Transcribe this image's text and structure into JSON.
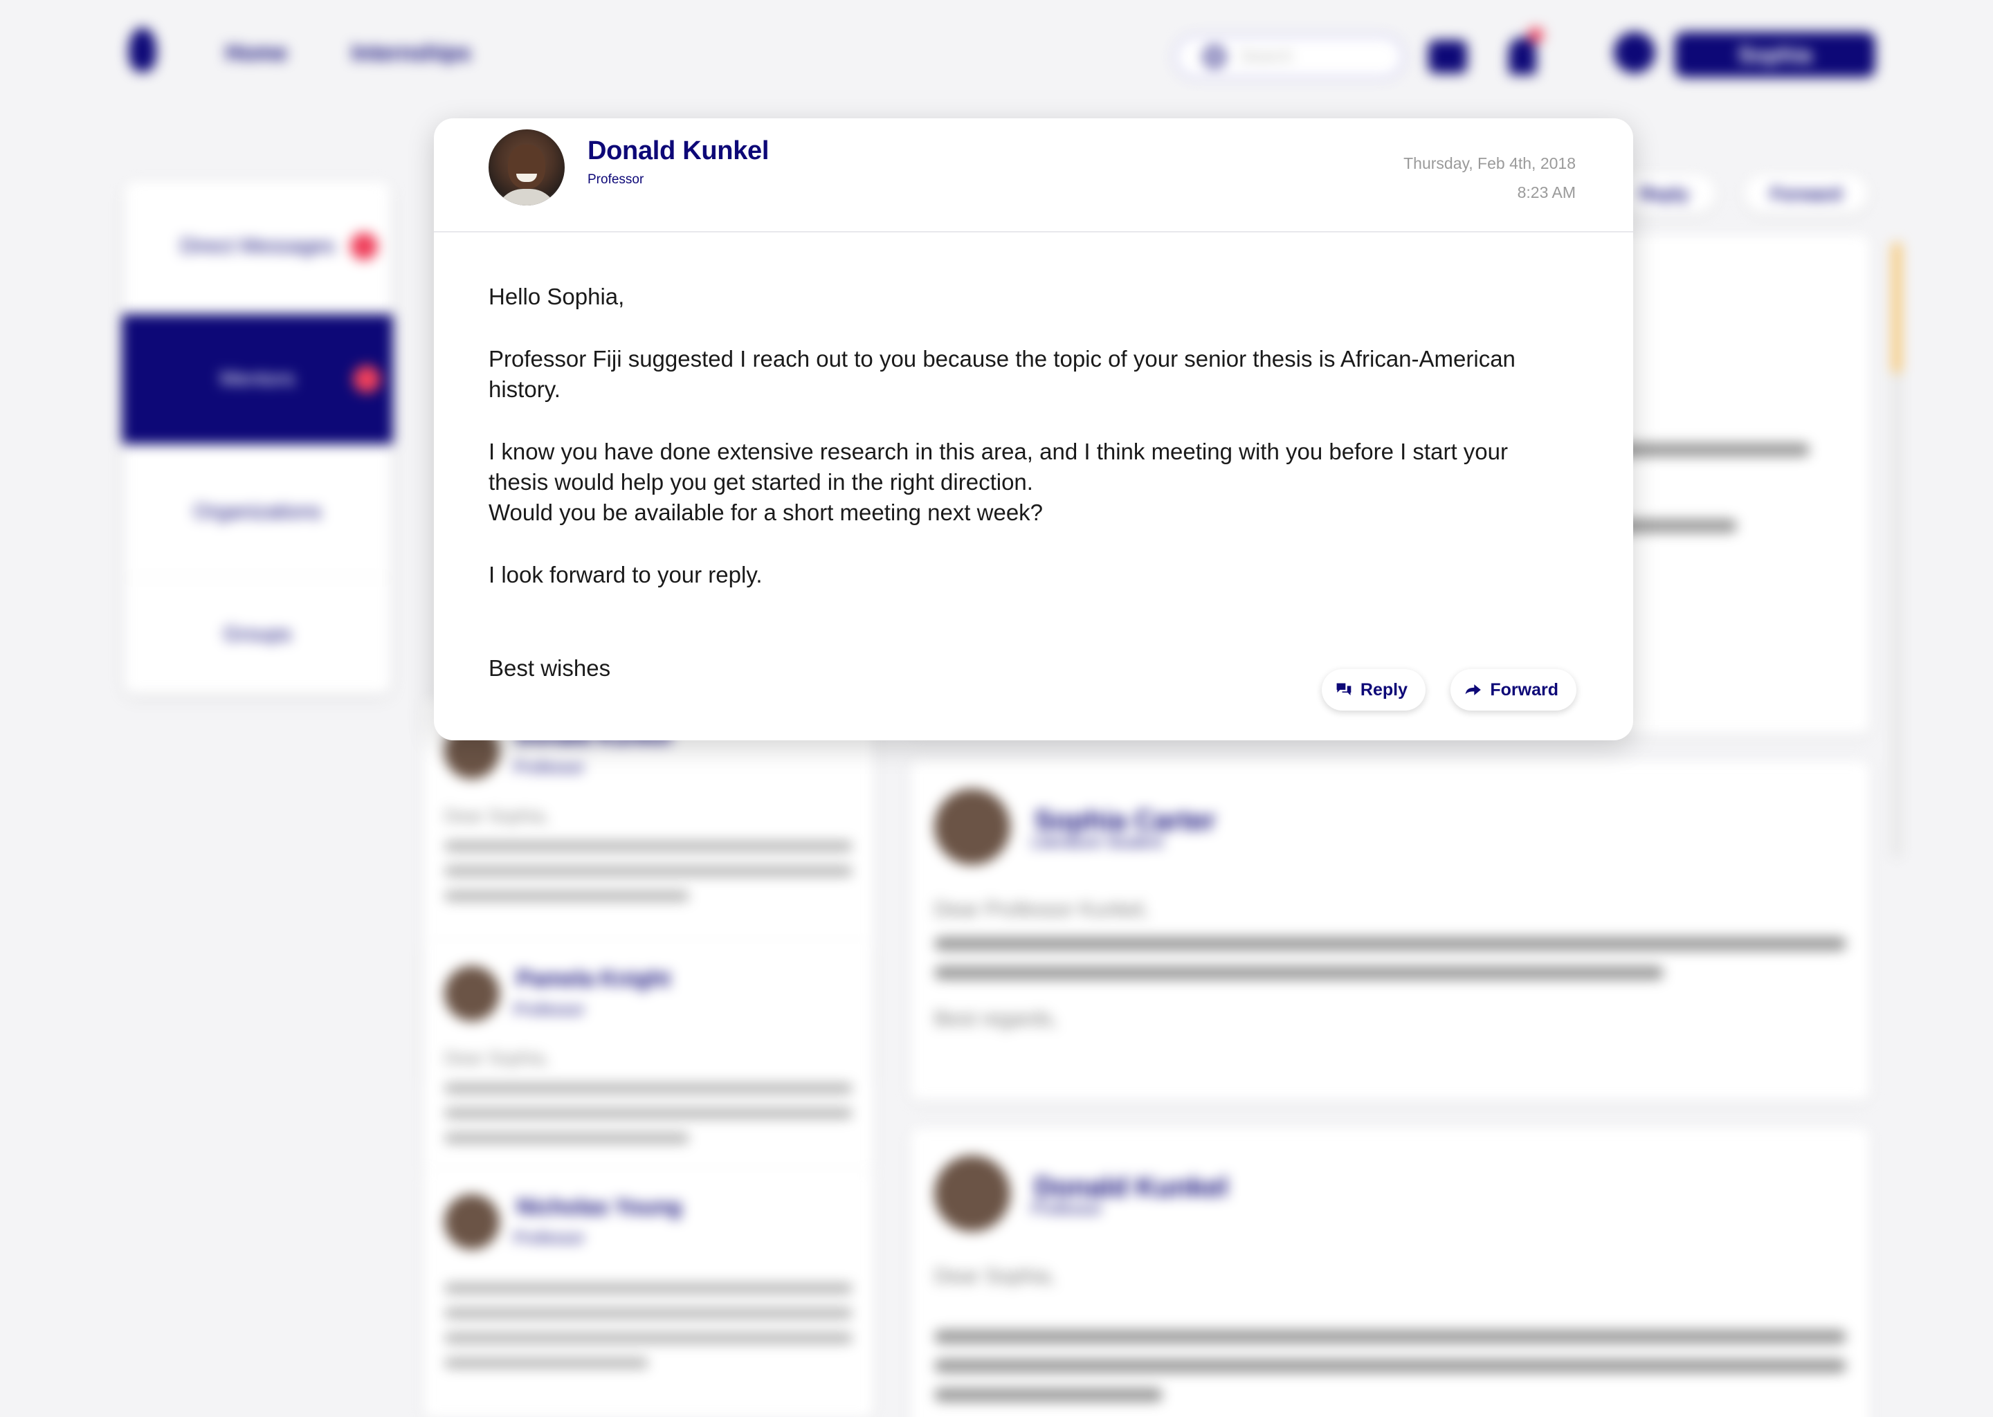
{
  "nav": {
    "links": [
      "Home",
      "Internships"
    ],
    "search_placeholder": "Search",
    "user_button": "Sophia"
  },
  "sidebar": {
    "items": [
      {
        "label": "Direct Messages",
        "badge": true
      },
      {
        "label": "Mentors",
        "badge": true,
        "active": true
      },
      {
        "label": "Organizations",
        "badge": false
      },
      {
        "label": "Groups",
        "badge": false
      }
    ]
  },
  "background_threads": [
    {
      "name": "Donald Kunkel",
      "role": "Professor",
      "greeting": "Dear Sophia,"
    },
    {
      "name": "Pamela Knight",
      "role": "Professor",
      "greeting": "Dear Sophia,"
    },
    {
      "name": "Nicholas Young",
      "role": "Professor",
      "greeting": ""
    }
  ],
  "background_detail": [
    {
      "name": "Sophia Carter",
      "role": "Literature Student",
      "greeting": "Dear Professor Kunkel,",
      "closing": "Best regards,"
    },
    {
      "name": "Donald Kunkel",
      "role": "Professor",
      "greeting": "Dear Sophia,",
      "closing": ""
    }
  ],
  "background_actions": {
    "reply": "Reply",
    "forward": "Forward"
  },
  "modal": {
    "sender_name": "Donald Kunkel",
    "sender_role": "Professor",
    "date": "Thursday, Feb 4th, 2018",
    "time": "8:23 AM",
    "greeting": "Hello Sophia,",
    "paragraph_1": "Professor Fiji suggested I reach out to you because the topic of your senior thesis is African-American history.",
    "paragraph_2a": "I know you have done extensive research in this area, and I think meeting with you before I start your thesis would help you get started in the right direction.",
    "paragraph_2b": "Would you be available for a short meeting next week?",
    "paragraph_3": "I look forward to your reply.",
    "signoff": "Best wishes",
    "reply_label": "Reply",
    "forward_label": "Forward"
  },
  "colors": {
    "brand": "#0d0877",
    "badge": "#ef3f5b",
    "accent_scroll": "#f6c878",
    "muted_text": "#9a9a9a"
  }
}
